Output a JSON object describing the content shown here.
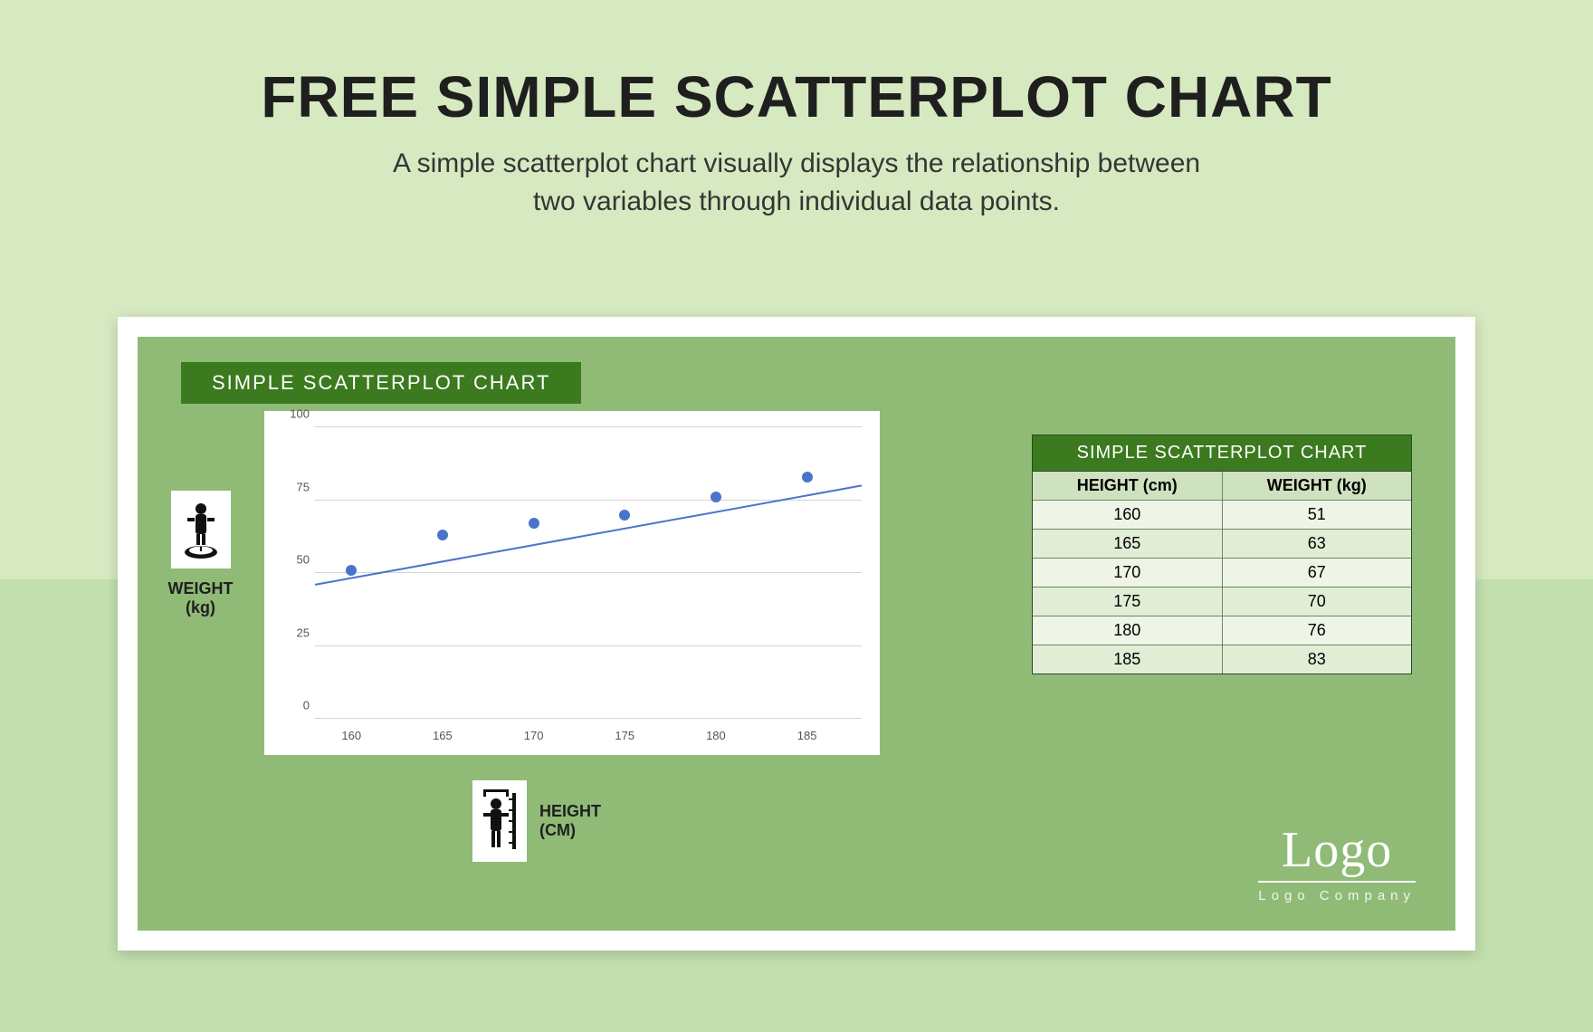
{
  "headline": "FREE SIMPLE SCATTERPLOT CHART",
  "subhead_line1": "A simple scatterplot chart visually displays the relationship between",
  "subhead_line2": "two variables through individual data points.",
  "ribbon": "SIMPLE SCATTERPLOT CHART",
  "axis_y_label_1": "WEIGHT",
  "axis_y_label_2": "(kg)",
  "axis_x_label_1": "HEIGHT",
  "axis_x_label_2": "(CM)",
  "table": {
    "title": "SIMPLE SCATTERPLOT CHART",
    "col1": "HEIGHT (cm)",
    "col2": "WEIGHT (kg)",
    "rows": [
      {
        "h": "160",
        "w": "51"
      },
      {
        "h": "165",
        "w": "63"
      },
      {
        "h": "170",
        "w": "67"
      },
      {
        "h": "175",
        "w": "70"
      },
      {
        "h": "180",
        "w": "76"
      },
      {
        "h": "185",
        "w": "83"
      }
    ]
  },
  "yticks": [
    "0",
    "25",
    "50",
    "75",
    "100"
  ],
  "xticks": [
    "160",
    "165",
    "170",
    "175",
    "180",
    "185"
  ],
  "logo": {
    "big": "Logo",
    "small": "Logo Company"
  },
  "chart_data": {
    "type": "scatter",
    "title": "SIMPLE SCATTERPLOT CHART",
    "xlabel": "HEIGHT (CM)",
    "ylabel": "WEIGHT (kg)",
    "xlim": [
      158,
      188
    ],
    "ylim": [
      0,
      100
    ],
    "x": [
      160,
      165,
      170,
      175,
      180,
      185
    ],
    "y": [
      51,
      63,
      67,
      70,
      76,
      83
    ],
    "grid": true,
    "trendline": {
      "x": [
        158,
        188
      ],
      "y": [
        46,
        80
      ]
    }
  }
}
